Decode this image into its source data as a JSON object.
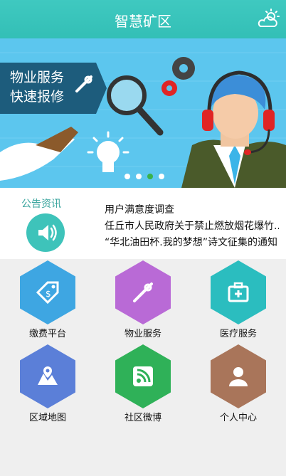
{
  "header": {
    "title": "智慧矿区",
    "weather_icon": "cloud-sun-icon"
  },
  "banner": {
    "line1": "物业服务",
    "line2": "快速报修",
    "indicator_count": 4,
    "active_index": 2
  },
  "notice": {
    "label": "公告资讯",
    "items": [
      "用户满意度调查",
      "任丘市人民政府关于禁止燃放烟花爆竹...",
      "“华北油田杯.我的梦想”诗文征集的通知"
    ]
  },
  "grid": [
    {
      "label": "缴费平台",
      "color": "#3ea6e2",
      "icon": "price-tag-icon"
    },
    {
      "label": "物业服务",
      "color": "#b96ad6",
      "icon": "tools-icon"
    },
    {
      "label": "医疗服务",
      "color": "#2bbdbf",
      "icon": "medical-kit-icon"
    },
    {
      "label": "区域地图",
      "color": "#5b7fd8",
      "icon": "map-pin-icon"
    },
    {
      "label": "社区微博",
      "color": "#2fb158",
      "icon": "rss-icon"
    },
    {
      "label": "个人中心",
      "color": "#a9755a",
      "icon": "person-icon"
    }
  ]
}
